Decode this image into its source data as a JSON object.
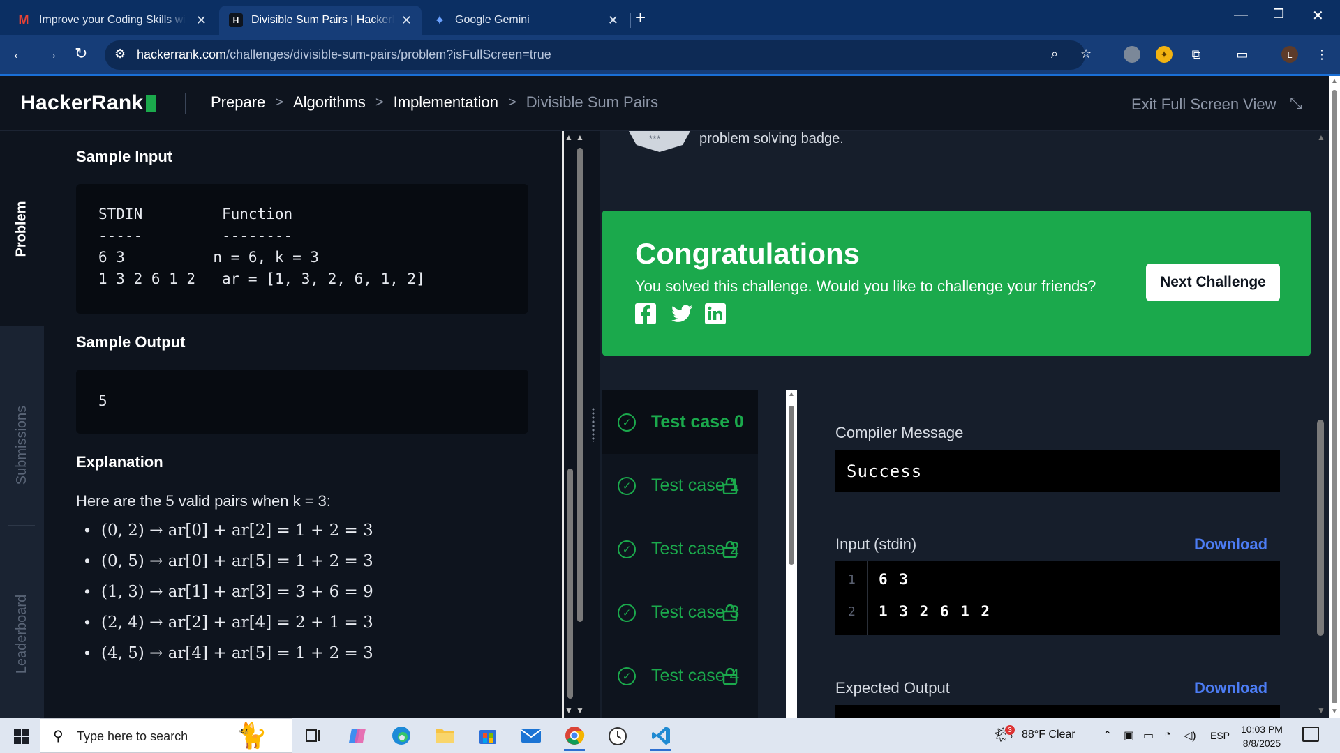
{
  "browser": {
    "tabs": [
      {
        "title": "Improve your Coding Skills with",
        "favicon": "gmail-icon",
        "active": false
      },
      {
        "title": "Divisible Sum Pairs | HackerRank",
        "favicon": "hackerrank-icon",
        "active": true
      },
      {
        "title": "Google Gemini",
        "favicon": "gemini-icon",
        "active": false
      }
    ],
    "url_host": "hackerrank.com",
    "url_path": "/challenges/divisible-sum-pairs/problem?isFullScreen=true",
    "profile_initial": "L"
  },
  "header": {
    "logo": "HackerRank",
    "breadcrumbs": [
      "Prepare",
      "Algorithms",
      "Implementation",
      "Divisible Sum Pairs"
    ],
    "exit_fullscreen": "Exit Full Screen View"
  },
  "leftnav": {
    "items": [
      "Problem",
      "Submissions",
      "Leaderboard"
    ]
  },
  "problem": {
    "sample_input_title": "Sample Input",
    "sample_input_lines": [
      "STDIN         Function",
      "-----         --------",
      "6 3          n = 6, k = 3",
      "1 3 2 6 1 2   ar = [1, 3, 2, 6, 1, 2]"
    ],
    "sample_output_title": "Sample Output",
    "sample_output": "5",
    "explanation_title": "Explanation",
    "explanation_text": "Here are the 5 valid pairs when k = 3:",
    "pairs": [
      "(0, 2) → ar[0] + ar[2] = 1 + 2 = 3",
      "(0, 5) → ar[0] + ar[5] = 1 + 2 = 3",
      "(1, 3) → ar[1] + ar[3] = 3 + 6 = 9",
      "(2, 4) → ar[2] + ar[4] = 2 + 1 = 3",
      "(4, 5) → ar[4] + ar[5] = 1 + 2 = 3"
    ]
  },
  "results": {
    "badge_text": "problem solving badge.",
    "badge_stars": "***",
    "congrats_title": "Congratulations",
    "congrats_sub": "You solved this challenge. Would you like to challenge your friends?",
    "next_challenge": "Next Challenge",
    "test_cases": [
      "Test case 0",
      "Test case 1",
      "Test case 2",
      "Test case 3",
      "Test case 4"
    ],
    "compiler_message_label": "Compiler Message",
    "compiler_message": "Success",
    "input_label": "Input (stdin)",
    "download": "Download",
    "stdin_lines": [
      {
        "n": "1",
        "text": "6 3"
      },
      {
        "n": "2",
        "text": "1 3 2 6 1 2"
      }
    ],
    "expected_output_label": "Expected Output"
  },
  "taskbar": {
    "search_placeholder": "Type here to search",
    "weather": "88°F  Clear",
    "weather_alerts": "3",
    "language": "ESP",
    "time": "10:03 PM",
    "date": "8/8/2025"
  },
  "colors": {
    "accent_green": "#1ba94c",
    "link_blue": "#4c7cf3",
    "background": "#0e141e"
  }
}
